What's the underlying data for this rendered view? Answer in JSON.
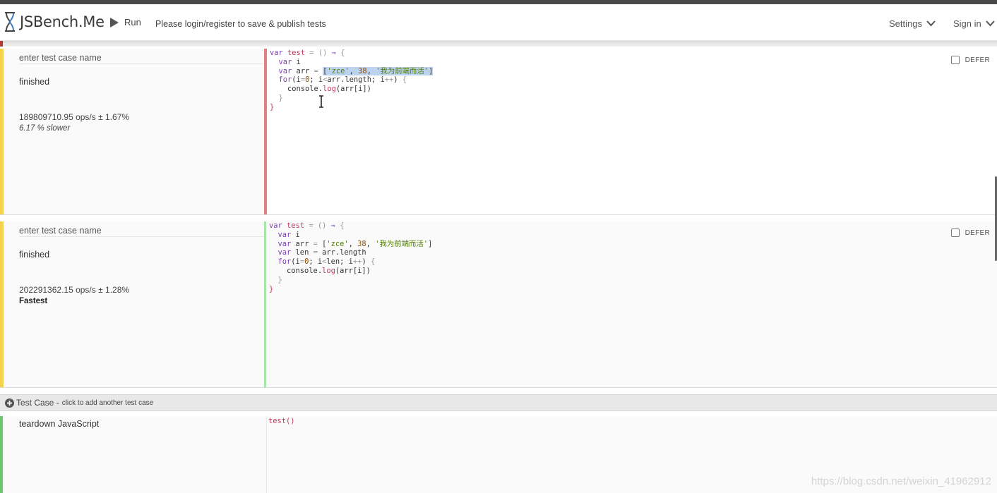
{
  "header": {
    "logo_text": "JSBench.Me",
    "run_label": "Run",
    "login_message": "Please login/register to save & publish tests",
    "settings_label": "Settings",
    "signin_label": "Sign in"
  },
  "test_cases": [
    {
      "name_placeholder": "enter test case name",
      "status": "finished",
      "ops": "189809710.95 ops/s ± 1.67%",
      "verdict": "6.17 % slower",
      "defer_label": "DEFER"
    },
    {
      "name_placeholder": "enter test case name",
      "status": "finished",
      "ops": "202291362.15 ops/s ± 1.28%",
      "verdict": "Fastest",
      "defer_label": "DEFER"
    }
  ],
  "add_case": {
    "label": "Test Case -",
    "hint": "click to add another test case"
  },
  "teardown": {
    "label": "teardown JavaScript",
    "code": "test()"
  },
  "watermark": "https://blog.csdn.net/weixin_41962912",
  "colors": {
    "case_stripe": "#f1d34d",
    "editor_border_slower": "#e08080",
    "editor_border_fastest": "#a6e6a6",
    "teardown_stripe": "#6cc76c"
  }
}
